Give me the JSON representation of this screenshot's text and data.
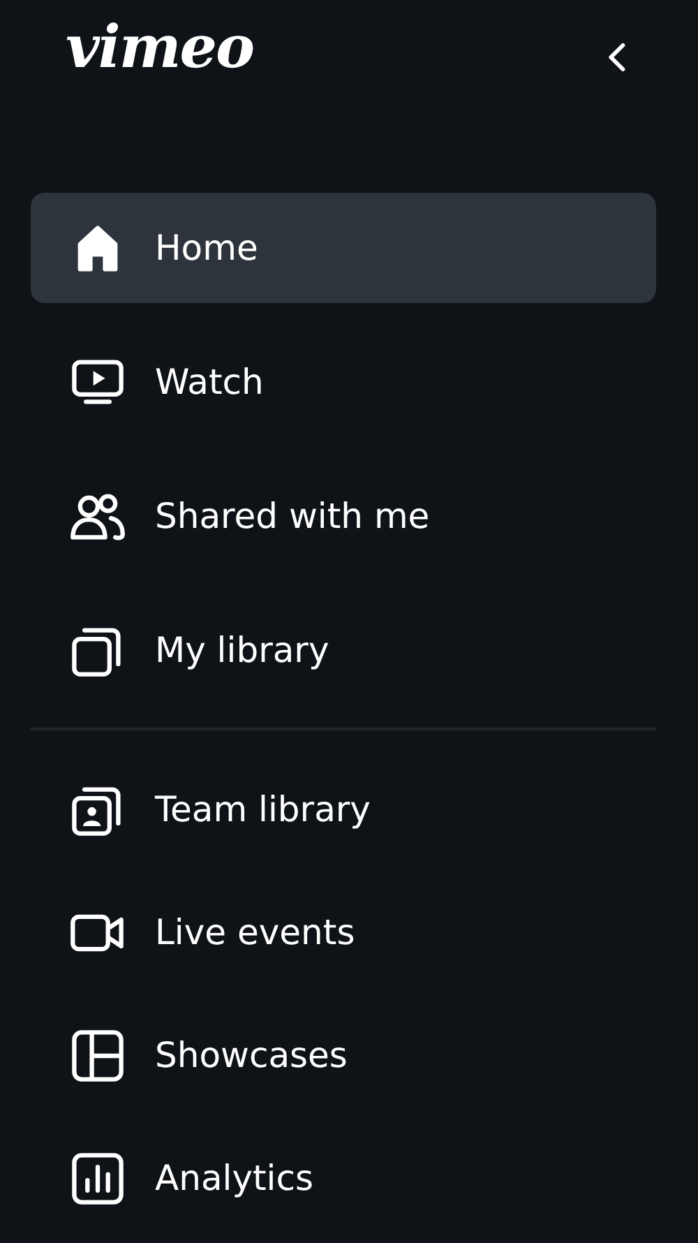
{
  "logo": "vimeo",
  "sections": [
    {
      "items": [
        {
          "label": "Home",
          "selected": true
        },
        {
          "label": "Watch",
          "selected": false
        },
        {
          "label": "Shared with me",
          "selected": false
        },
        {
          "label": "My library",
          "selected": false
        }
      ]
    },
    {
      "items": [
        {
          "label": "Team library",
          "selected": false
        },
        {
          "label": "Live events",
          "selected": false
        },
        {
          "label": "Showcases",
          "selected": false
        },
        {
          "label": "Analytics",
          "selected": false
        }
      ]
    }
  ]
}
